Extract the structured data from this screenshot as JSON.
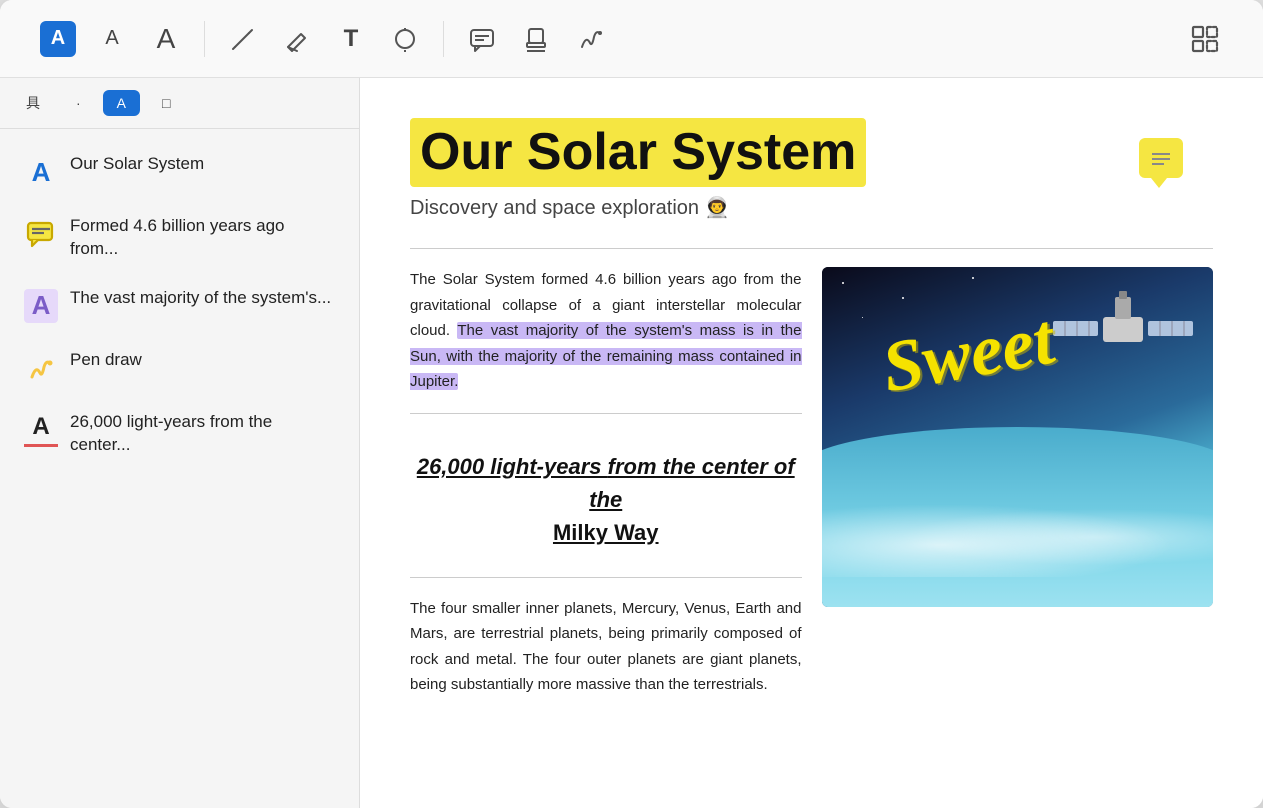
{
  "toolbar": {
    "groups": [
      {
        "name": "text-tools",
        "items": [
          {
            "id": "font-icon",
            "icon": "🅰",
            "label": "Font",
            "type": "blue-bg"
          },
          {
            "id": "font-size-small",
            "icon": "A",
            "label": "Font size small"
          },
          {
            "id": "font-size-large",
            "icon": "A",
            "label": "Font size large"
          }
        ]
      },
      {
        "name": "draw-tools",
        "items": [
          {
            "id": "pen-tool",
            "icon": "✏️",
            "label": "Pen"
          },
          {
            "id": "eraser-tool",
            "icon": "◇",
            "label": "Eraser"
          },
          {
            "id": "text-tool",
            "icon": "T",
            "label": "Text"
          },
          {
            "id": "shape-tool",
            "icon": "⊙",
            "label": "Shape"
          }
        ]
      },
      {
        "name": "annotation-tools",
        "items": [
          {
            "id": "comment-tool",
            "icon": "💬",
            "label": "Comment"
          },
          {
            "id": "stamp-tool",
            "icon": "🖃",
            "label": "Stamp"
          },
          {
            "id": "signature-tool",
            "icon": "✒️",
            "label": "Signature"
          }
        ]
      },
      {
        "name": "layout-tools",
        "items": [
          {
            "id": "grid-tool",
            "icon": "⋯",
            "label": "Grid"
          }
        ]
      }
    ]
  },
  "sidebar": {
    "tabs": [
      {
        "id": "tab-kanji",
        "label": "具",
        "active": false
      },
      {
        "id": "tab-dots",
        "label": "·",
        "active": false
      },
      {
        "id": "tab-font",
        "label": "A",
        "active": true,
        "icon_bg": "blue"
      },
      {
        "id": "tab-doc",
        "label": "□",
        "active": false
      }
    ],
    "items": [
      {
        "id": "item-title",
        "icon": "A",
        "icon_color": "blue",
        "text": "Our Solar System",
        "type": "heading"
      },
      {
        "id": "item-comment",
        "icon": "comment",
        "icon_color": "yellow",
        "text": "Formed 4.6 billion years ago from...",
        "type": "comment"
      },
      {
        "id": "item-highlight",
        "icon": "A",
        "icon_color": "purple",
        "text": "The vast majority of the system's...",
        "type": "highlight"
      },
      {
        "id": "item-pen",
        "icon": "pen",
        "icon_color": "yellow",
        "text": "Pen draw",
        "type": "pen"
      },
      {
        "id": "item-underline",
        "icon": "A",
        "icon_color": "red-underline",
        "text": "26,000 light-years from the center...",
        "type": "underline"
      }
    ]
  },
  "document": {
    "title": "Our Solar System",
    "subtitle": "Discovery and space exploration 👨‍🚀",
    "body1": "The Solar System formed 4.6 billion years ago from the gravitational collapse of a giant interstellar molecular cloud.",
    "body1_highlighted": "The vast majority of the system's mass is in the Sun, with the majority of the remaining mass contained in Jupiter.",
    "quote_line1": "26,000 light-years",
    "quote_line2": "from the center of the",
    "quote_line3": "Milky Way",
    "body2": "The four smaller inner planets, Mercury, Venus, Earth and Mars, are terrestrial planets, being primarily composed of rock and metal. The four outer planets are giant planets, being substantially more massive than the terrestrials.",
    "sweet_text": "Sweet",
    "comment_icon": "≡"
  }
}
